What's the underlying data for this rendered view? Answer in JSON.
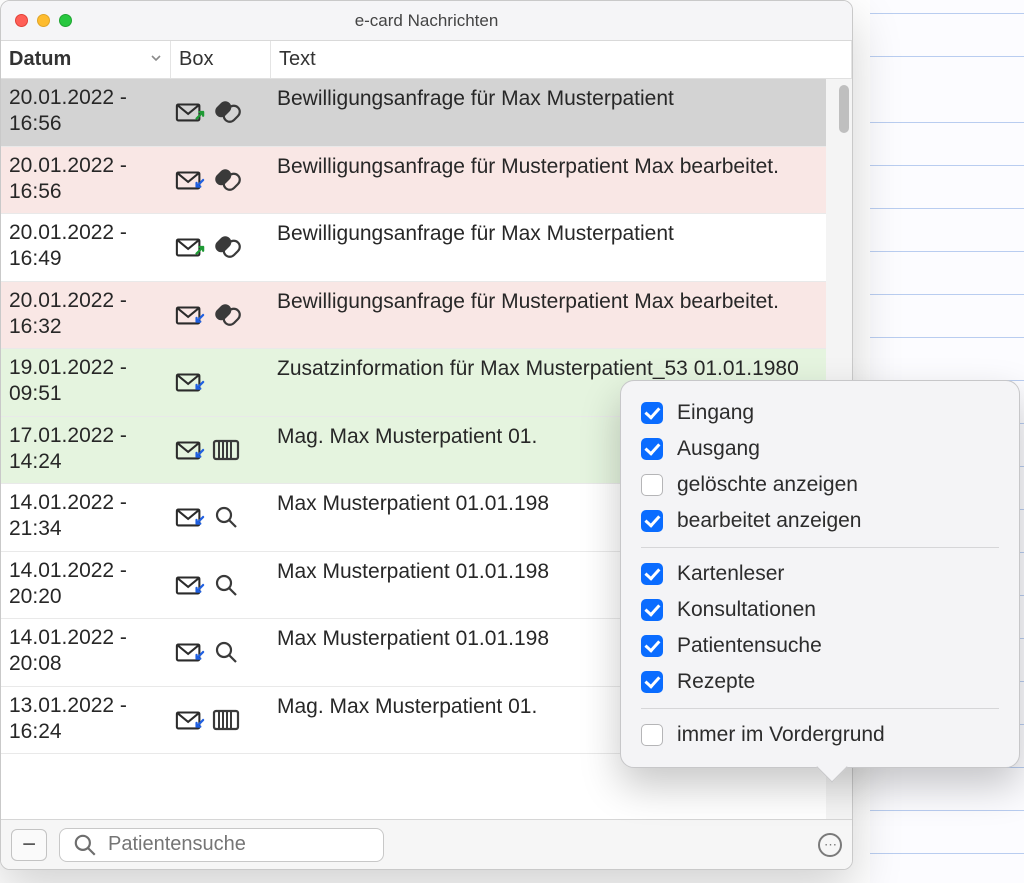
{
  "window": {
    "title": "e-card Nachrichten"
  },
  "columns": {
    "datum": "Datum",
    "box": "Box",
    "text": "Text"
  },
  "rows": [
    {
      "datum": "20.01.2022 - 16:56",
      "icons": [
        "mail-out",
        "pill"
      ],
      "text": "Bewilligungsanfrage für Max Musterpatient",
      "bg": "selected"
    },
    {
      "datum": "20.01.2022 - 16:56",
      "icons": [
        "mail-in",
        "pill"
      ],
      "text": "Bewilligungsanfrage für Musterpatient Max bearbeitet.",
      "bg": "pink"
    },
    {
      "datum": "20.01.2022 - 16:49",
      "icons": [
        "mail-out",
        "pill"
      ],
      "text": "Bewilligungsanfrage für Max Musterpatient",
      "bg": ""
    },
    {
      "datum": "20.01.2022 - 16:32",
      "icons": [
        "mail-in",
        "pill"
      ],
      "text": "Bewilligungsanfrage für Musterpatient Max bearbeitet.",
      "bg": "pink"
    },
    {
      "datum": "19.01.2022 - 09:51",
      "icons": [
        "mail-in"
      ],
      "text": "Zusatzinformation für Max Musterpatient_53 01.01.1980",
      "bg": "green"
    },
    {
      "datum": "17.01.2022 - 14:24",
      "icons": [
        "mail-in",
        "card"
      ],
      "text": "Mag. Max Musterpatient 01.",
      "bg": "green"
    },
    {
      "datum": "14.01.2022 - 21:34",
      "icons": [
        "mail-in",
        "search"
      ],
      "text": "Max Musterpatient 01.01.198",
      "bg": ""
    },
    {
      "datum": "14.01.2022 - 20:20",
      "icons": [
        "mail-in",
        "search"
      ],
      "text": "Max Musterpatient 01.01.198",
      "bg": ""
    },
    {
      "datum": "14.01.2022 - 20:08",
      "icons": [
        "mail-in",
        "search"
      ],
      "text": "Max Musterpatient 01.01.198",
      "bg": ""
    },
    {
      "datum": "13.01.2022 - 16:24",
      "icons": [
        "mail-in",
        "card"
      ],
      "text": "Mag. Max Musterpatient 01.",
      "bg": ""
    }
  ],
  "search": {
    "placeholder": "Patientensuche"
  },
  "popover": {
    "group1": [
      {
        "label": "Eingang",
        "checked": true
      },
      {
        "label": "Ausgang",
        "checked": true
      },
      {
        "label": "gelöschte anzeigen",
        "checked": false
      },
      {
        "label": "bearbeitet anzeigen",
        "checked": true
      }
    ],
    "group2": [
      {
        "label": "Kartenleser",
        "checked": true
      },
      {
        "label": "Konsultationen",
        "checked": true
      },
      {
        "label": "Patientensuche",
        "checked": true
      },
      {
        "label": "Rezepte",
        "checked": true
      }
    ],
    "group3": [
      {
        "label": "immer im Vordergrund",
        "checked": false
      }
    ]
  }
}
